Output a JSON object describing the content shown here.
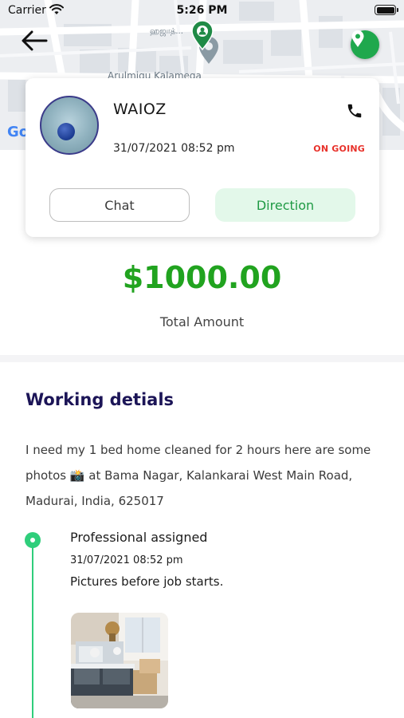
{
  "status_bar": {
    "carrier": "Carrier",
    "time": "5:26 PM"
  },
  "map": {
    "labels": [
      "ஹஜாத்...",
      "Arulmigu Kalamega"
    ],
    "google_mark": "Go"
  },
  "order": {
    "customer_name": "WAIOZ",
    "datetime": "31/07/2021 08:52 pm",
    "status": "ON GOING",
    "chat_label": "Chat",
    "direction_label": "Direction"
  },
  "payment": {
    "amount": "$1000.00",
    "amount_label": "Total Amount"
  },
  "details": {
    "title": "Working detials",
    "description": "I need my 1 bed home cleaned for 2 hours  here are some photos 📸 at Bama Nagar, Kalankarai West Main Road, Madurai, India, 625017"
  },
  "timeline": [
    {
      "title": "Professional assigned",
      "datetime": "31/07/2021 08:52 pm",
      "note": "Pictures  before job starts."
    }
  ],
  "colors": {
    "accent_green": "#21a31f",
    "status_red": "#e8322b",
    "timeline_green": "#2fce7b",
    "title_navy": "#1c1557"
  },
  "icons": [
    "back-arrow-icon",
    "location-pin-icon",
    "phone-icon",
    "wifi-icon",
    "battery-icon"
  ]
}
